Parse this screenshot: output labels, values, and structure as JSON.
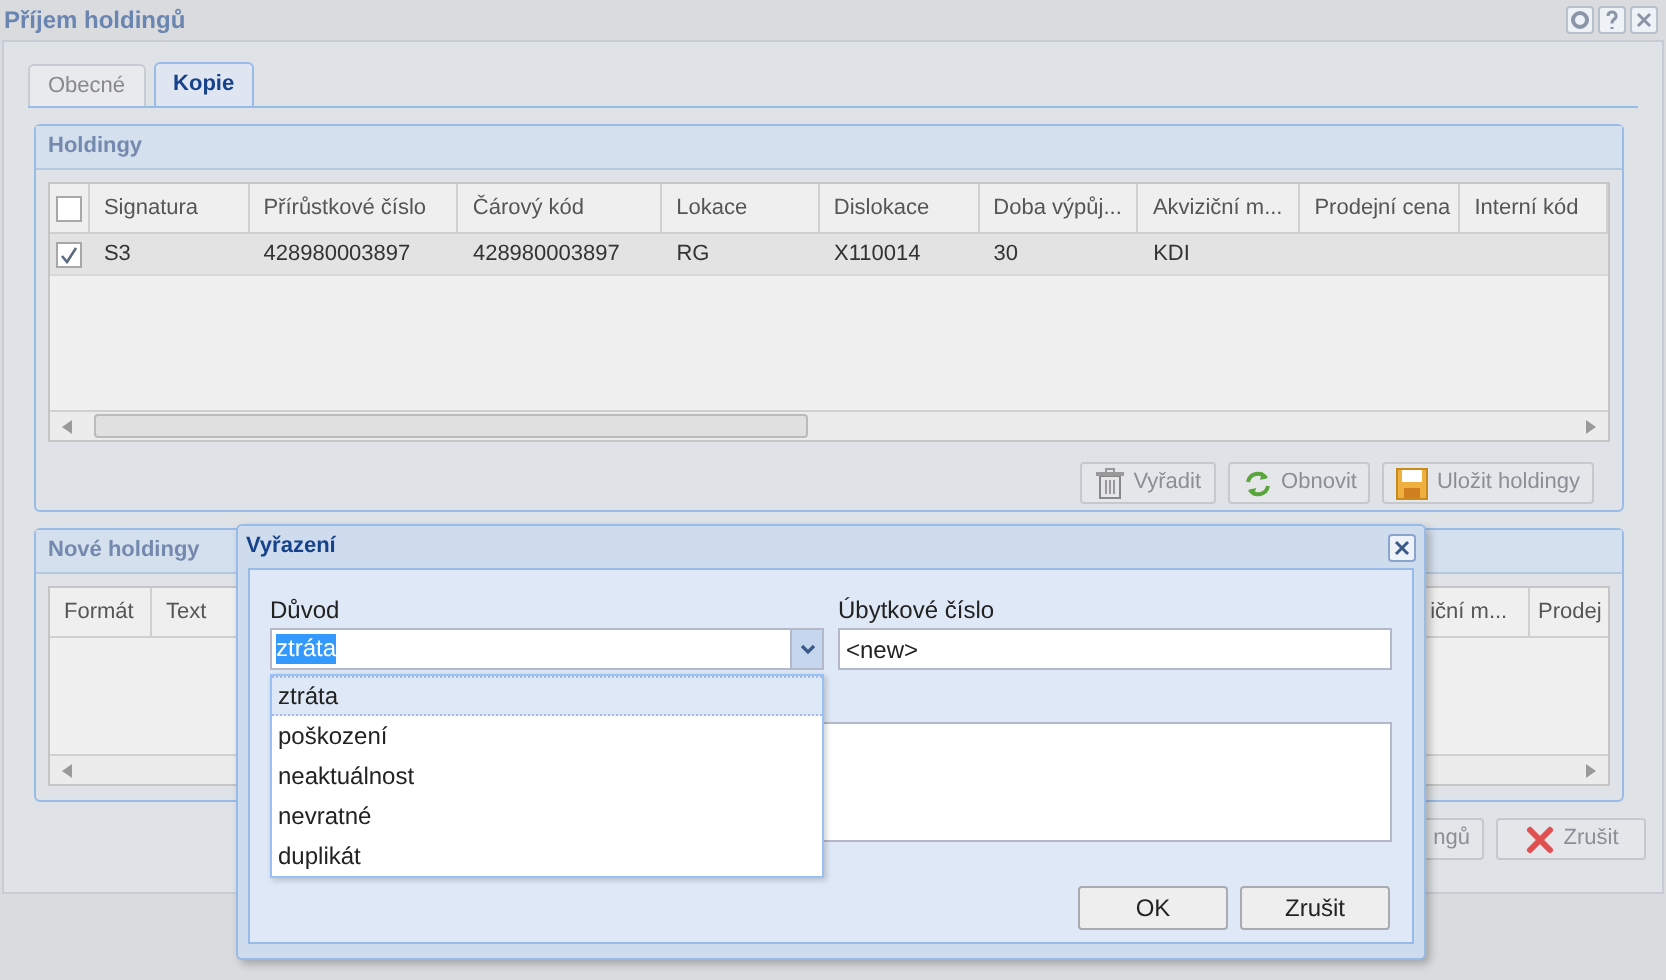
{
  "window": {
    "title": "Příjem holdingů"
  },
  "tabs": [
    {
      "label": "Obecné",
      "selected": false
    },
    {
      "label": "Kopie",
      "selected": true
    }
  ],
  "holdings": {
    "title": "Holdingy",
    "header_checked": false,
    "columns": [
      "Signatura",
      "Přírůstkové číslo",
      "Čárový kód",
      "Lokace",
      "Dislokace",
      "Doba výpůj...",
      "Akviziční m...",
      "Prodejní cena",
      "Interní kód"
    ],
    "rows": [
      {
        "checked": true,
        "cells": [
          "S3",
          "428980003897",
          "428980003897",
          "RG",
          "X110014",
          "30",
          "KDI",
          "",
          ""
        ]
      }
    ],
    "buttons": [
      {
        "label": "Vyřadit",
        "kind": "trash"
      },
      {
        "label": "Obnovit",
        "kind": "refresh"
      },
      {
        "label": "Uložit holdingy",
        "kind": "save"
      }
    ]
  },
  "new_holdings": {
    "title": "Nové holdingy",
    "columns": [
      "Formát",
      "Text"
    ],
    "columns_right": [
      "iční m...",
      "Prodej"
    ],
    "buttons": [
      {
        "label": "ngů",
        "kind": "plain"
      },
      {
        "label": "Zrušit",
        "kind": "cancel"
      }
    ]
  },
  "dialog": {
    "title": "Vyřazení",
    "reason": {
      "label": "Důvod",
      "value": "ztráta",
      "options": [
        {
          "label": "ztráta",
          "selected": true
        },
        {
          "label": "poškození",
          "selected": false
        },
        {
          "label": "neaktuálnost",
          "selected": false
        },
        {
          "label": "nevratné",
          "selected": false
        },
        {
          "label": "duplikát",
          "selected": false
        }
      ]
    },
    "number": {
      "label": "Úbytkové číslo",
      "value": "<new>"
    },
    "buttons": [
      "OK",
      "Zrušit"
    ]
  }
}
